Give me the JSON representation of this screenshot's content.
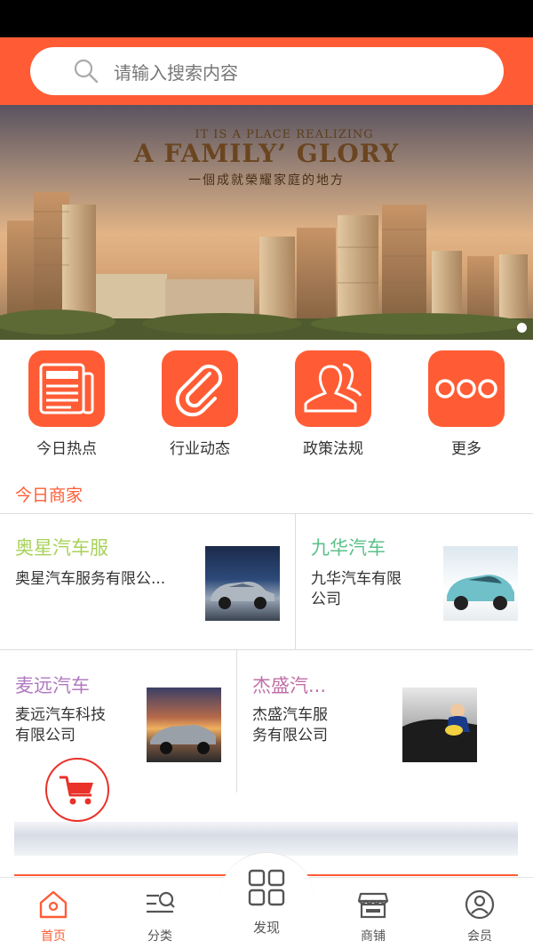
{
  "search": {
    "placeholder": "请输入搜索内容"
  },
  "banner": {
    "line1": "IT IS A PLACE REALIZING",
    "line2": "A FAMILY’ GLORY",
    "line3": "一個成就榮耀家庭的地方"
  },
  "quick_nav": [
    {
      "label": "今日热点",
      "icon": "newspaper-icon"
    },
    {
      "label": "行业动态",
      "icon": "paperclip-icon"
    },
    {
      "label": "政策法规",
      "icon": "users-icon"
    },
    {
      "label": "更多",
      "icon": "more-icon"
    }
  ],
  "section": {
    "title": "今日商家"
  },
  "shops": [
    {
      "name": "奥星汽车服",
      "desc": "奥星汽车服务有限公...",
      "name_color": "#a8d25a"
    },
    {
      "name": "九华汽车",
      "desc": "九华汽车有限\n公司",
      "name_color": "#5cc08a"
    },
    {
      "name": "麦远汽车",
      "desc": "麦远汽车科技\n有限公司",
      "name_color": "#b07ac0"
    },
    {
      "name": "杰盛汽...",
      "desc": "杰盛汽车服\n务有限公司",
      "name_color": "#c070a8"
    }
  ],
  "tabbar": {
    "home": "首页",
    "category": "分类",
    "discover": "发现",
    "shop": "商铺",
    "member": "会员"
  },
  "colors": {
    "accent": "#ff5c35",
    "cart": "#e8322a"
  }
}
